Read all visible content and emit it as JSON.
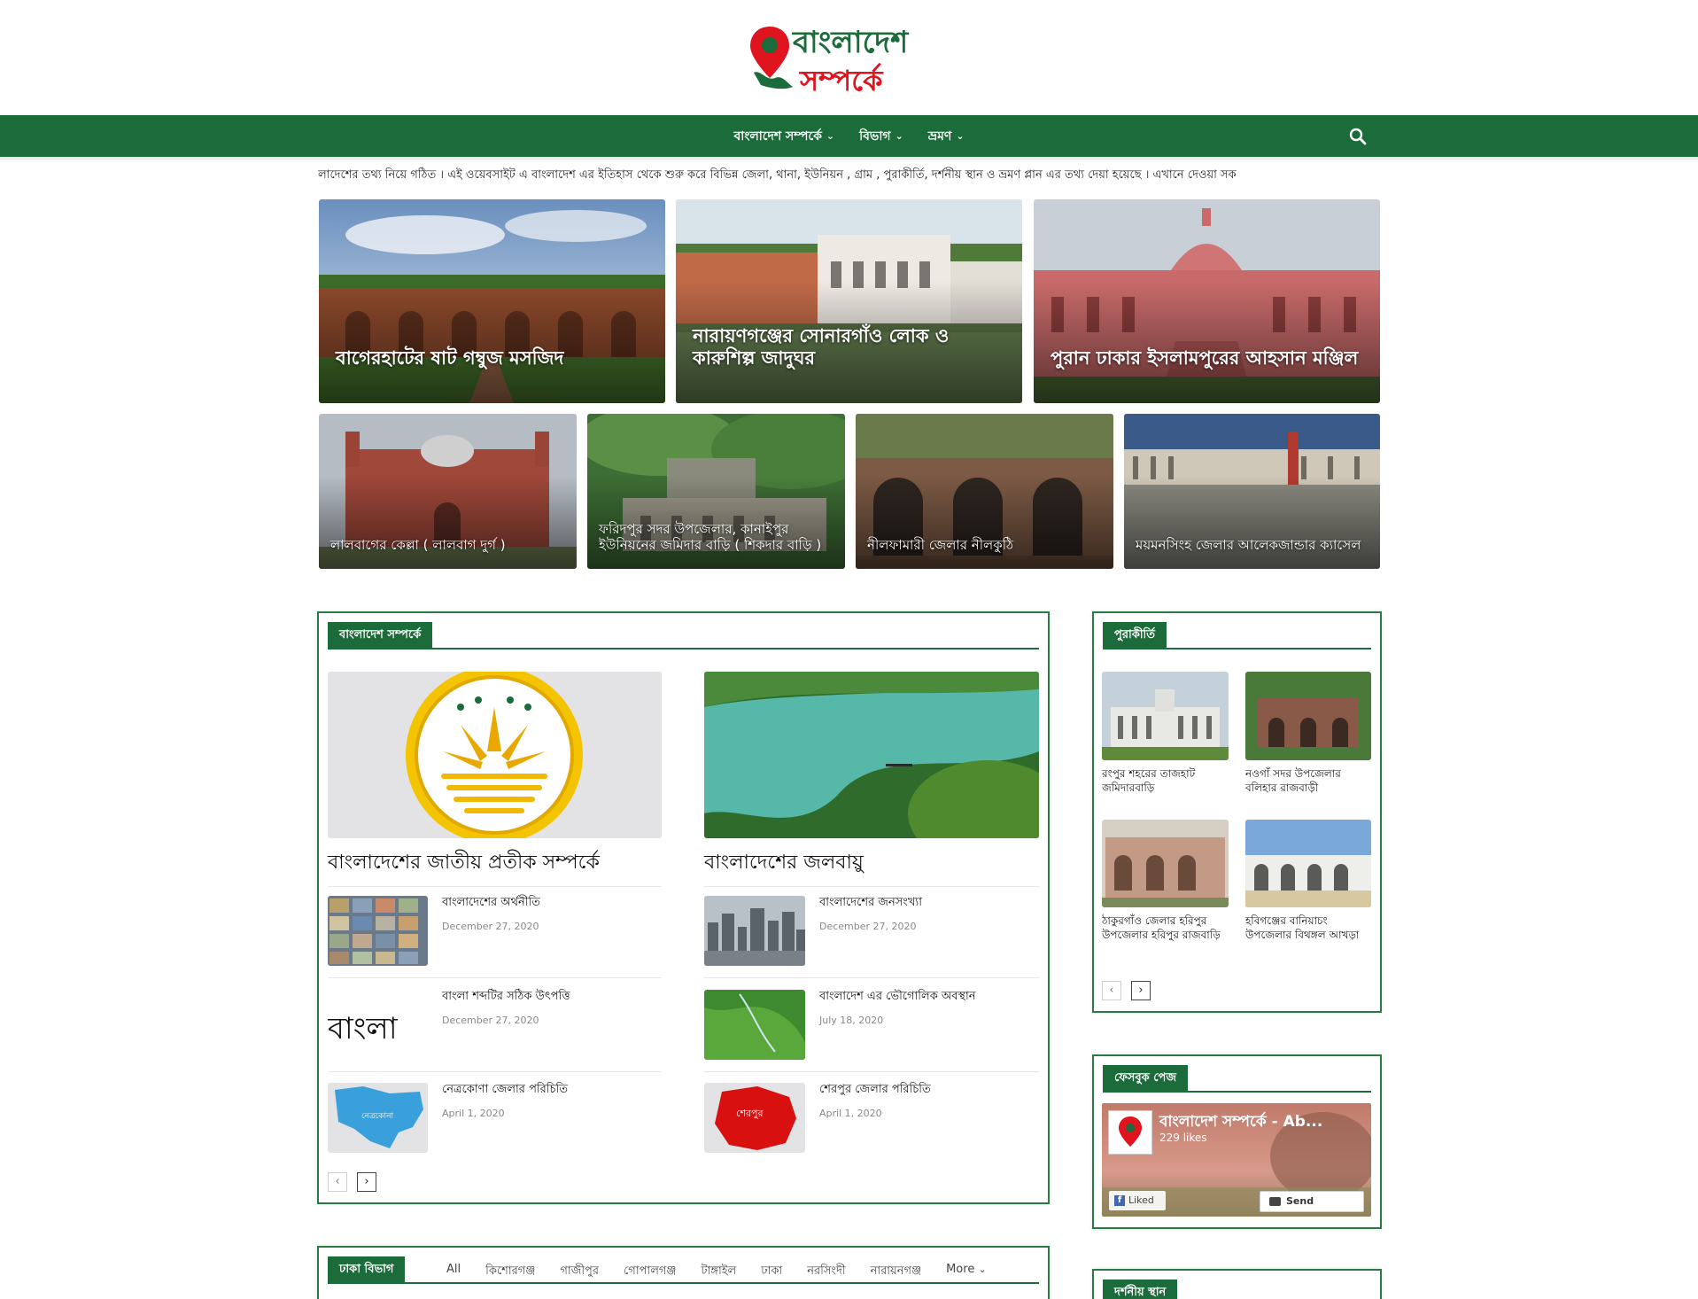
{
  "site": {
    "logo_line1": "বাংলাদেশ",
    "logo_line2": "সম্পর্কে",
    "brand_green": "#1c6b3a",
    "brand_red": "#e0141e"
  },
  "nav": {
    "items": [
      {
        "label": "বাংলাদেশ সম্পর্কে",
        "icon": "chevron-down-icon"
      },
      {
        "label": "বিভাগ",
        "icon": "chevron-down-icon"
      },
      {
        "label": "ভ্রমণ",
        "icon": "chevron-down-icon"
      }
    ],
    "search_icon": "search-icon"
  },
  "ticker": {
    "text": "লাদেশের তথ্য নিয়ে গঠিত । এই ওয়েবসাইট এ বাংলাদেশ এর ইতিহাস থেকে শুরু করে বিভিন্ন জেলা, থানা, ইউনিয়ন , গ্রাম , পুরাকীর্তি, দর্শনীয় স্থান ও ভ্রমণ প্লান এর তথ্য দেয়া হয়েছে । এখানে দেওয়া সক"
  },
  "featured": {
    "large": [
      {
        "title": "বাগেরহাটের ষাট গম্বুজ মসজিদ"
      },
      {
        "title": "নারায়ণগঞ্জের সোনারগাঁও লোক ও কারুশিল্প জাদুঘর"
      },
      {
        "title": "পুরান ঢাকার ইসলামপুরের আহসান মঞ্জিল"
      }
    ],
    "small": [
      {
        "title": "লালবাগের কেল্লা ( লালবাগ দুর্গ )"
      },
      {
        "title": "ফরিদপুর সদর উপজেলার, কানাইপুর ইউনিয়নের জমিদার বাড়ি ( শিকদার বাড়ি )"
      },
      {
        "title": "নীলফামারী জেলার নীলকুঠি"
      },
      {
        "title": "ময়মনসিংহ জেলার আলেকজান্ডার ক্যাসেল"
      }
    ]
  },
  "about_block": {
    "title": "বাংলাদেশ সম্পর্কে",
    "leads": [
      {
        "title": "বাংলাদেশের জাতীয় প্রতীক সম্পর্কে"
      },
      {
        "title": "বাংলাদেশের জলবায়ু"
      }
    ],
    "left_items": [
      {
        "title": "বাংলাদেশের অর্থনীতি",
        "date": "December 27, 2020"
      },
      {
        "title": "বাংলা শব্দটির সঠিক উৎপত্তি",
        "date": "December 27, 2020",
        "thumb_text": "বাংলা"
      },
      {
        "title": "নেত্রকোণা জেলার পরিচিতি",
        "date": "April 1, 2020",
        "thumb_text": "নেত্রকোনা"
      }
    ],
    "right_items": [
      {
        "title": "বাংলাদেশের জনসংখ্যা",
        "date": "December 27, 2020"
      },
      {
        "title": "বাংলাদেশ এর ভৌগোলিক অবস্থান",
        "date": "July 18, 2020"
      },
      {
        "title": "শেরপুর জেলার পরিচিতি",
        "date": "April 1, 2020",
        "thumb_text": "শেরপুর"
      }
    ],
    "prev": "‹",
    "next": "›"
  },
  "heritage_block": {
    "title": "পুরাকীর্তি",
    "items": [
      {
        "title": "রংপুর শহরের তাজহাট জমিদারবাড়ি"
      },
      {
        "title": "নওগাঁ সদর উপজেলার বলিহার রাজবাড়ী"
      },
      {
        "title": "ঠাকুরগাঁও জেলার হরিপুর উপজেলার হরিপুর রাজবাড়ি"
      },
      {
        "title": "হবিগঞ্জের বানিয়াচং উপজেলার বিথঙ্গল আখড়া"
      }
    ],
    "prev": "‹",
    "next": "›"
  },
  "facebook_block": {
    "title": "ফেসবুক পেজ",
    "page_name": "বাংলাদেশ সম্পর্কে - Ab...",
    "likes": "229 likes",
    "liked_label": "Liked",
    "send_label": "Send Message"
  },
  "dhaka_block": {
    "title": "ঢাকা বিভাগ",
    "tabs": [
      "All",
      "কিশোরগঞ্জ",
      "গাজীপুর",
      "গোপালগঞ্জ",
      "টাঙ্গাইল",
      "ঢাকা",
      "নরসিংদী",
      "নারায়নগঞ্জ",
      "More"
    ]
  },
  "sight_block": {
    "title": "দর্শনীয় স্থান"
  }
}
